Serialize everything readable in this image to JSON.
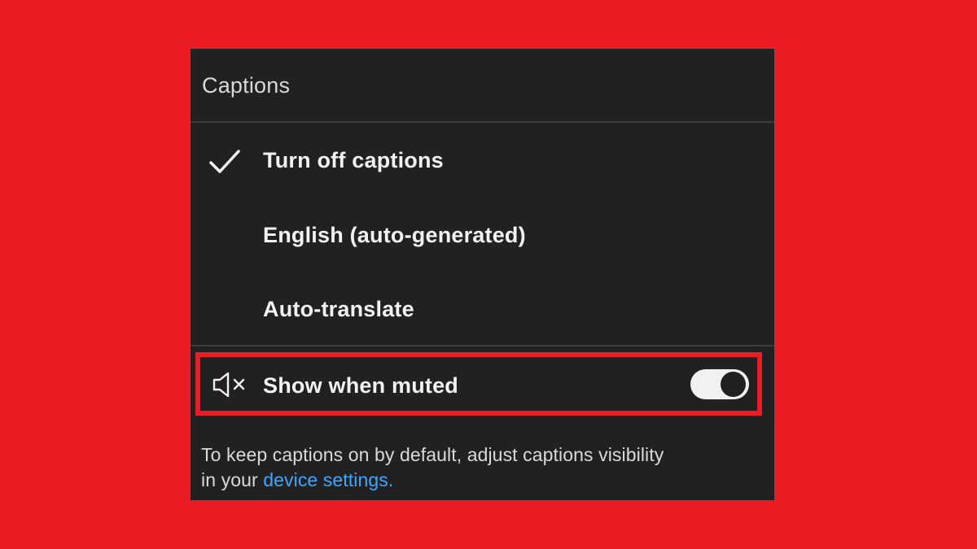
{
  "captions_menu": {
    "title": "Captions",
    "options": [
      {
        "label": "Turn off captions",
        "selected": true
      },
      {
        "label": "English (auto-generated)",
        "selected": false
      },
      {
        "label": "Auto-translate",
        "selected": false
      }
    ],
    "show_when_muted": {
      "label": "Show when muted",
      "icon": "volume-muted-icon",
      "toggle_on": true
    },
    "footnote": {
      "text_line1": "To keep captions on by default, adjust captions visibility",
      "text_line2_prefix": "in your ",
      "link_text": "device settings",
      "text_suffix": "."
    }
  },
  "colors": {
    "background": "#ec1c24",
    "panel": "#212121",
    "highlight_border": "#ec1c24",
    "link": "#3ea6ff",
    "toggle_track": "#f1f1f1"
  }
}
